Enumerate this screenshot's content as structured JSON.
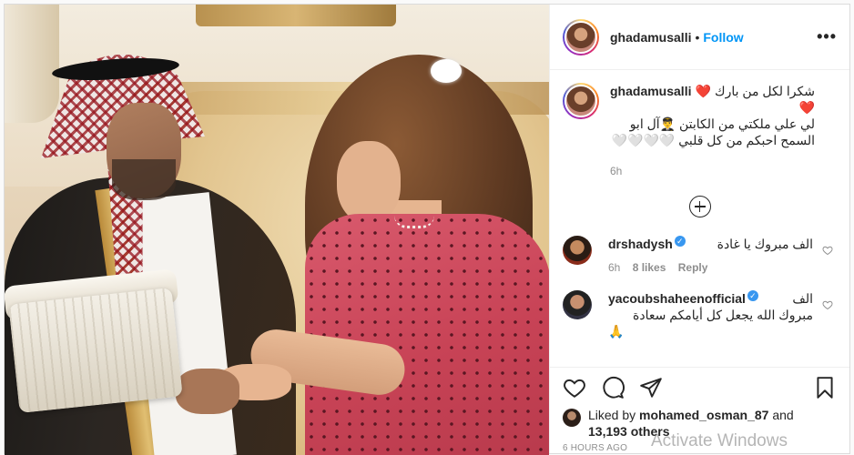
{
  "post": {
    "author": "ghadamusalli",
    "separator": "•",
    "follow_label": "Follow",
    "more_icon": "•••"
  },
  "caption": {
    "username": "ghadamusalli",
    "line1": "شكرا لكل من بارك ❤️❤️",
    "line2": "لي علي ملكتي من الكابتن 👨‍✈️آل ابو",
    "line3": "السمح احبكم من كل قلبي 🤍🤍🤍🤍",
    "time": "6h"
  },
  "comments": [
    {
      "username": "drshadysh",
      "verified": true,
      "text": "الف مبروك يا غادة",
      "time": "6h",
      "likes": "8 likes",
      "reply": "Reply"
    },
    {
      "username": "yacoubshaheenofficial",
      "verified": true,
      "text_line1": "الف",
      "text_line2": "مبروك الله يجعل كل أيامكم سعادة",
      "text_line3": "🙏"
    }
  ],
  "likes": {
    "prefix": "Liked by",
    "user": "mohamed_osman_87",
    "joiner": "and",
    "others": "13,193 others"
  },
  "timestamp": "6 HOURS AGO",
  "watermark": "Activate Windows",
  "icons": {
    "like": "heart-outline-icon",
    "comment": "comment-bubble-icon",
    "share": "paper-plane-icon",
    "save": "bookmark-icon"
  }
}
